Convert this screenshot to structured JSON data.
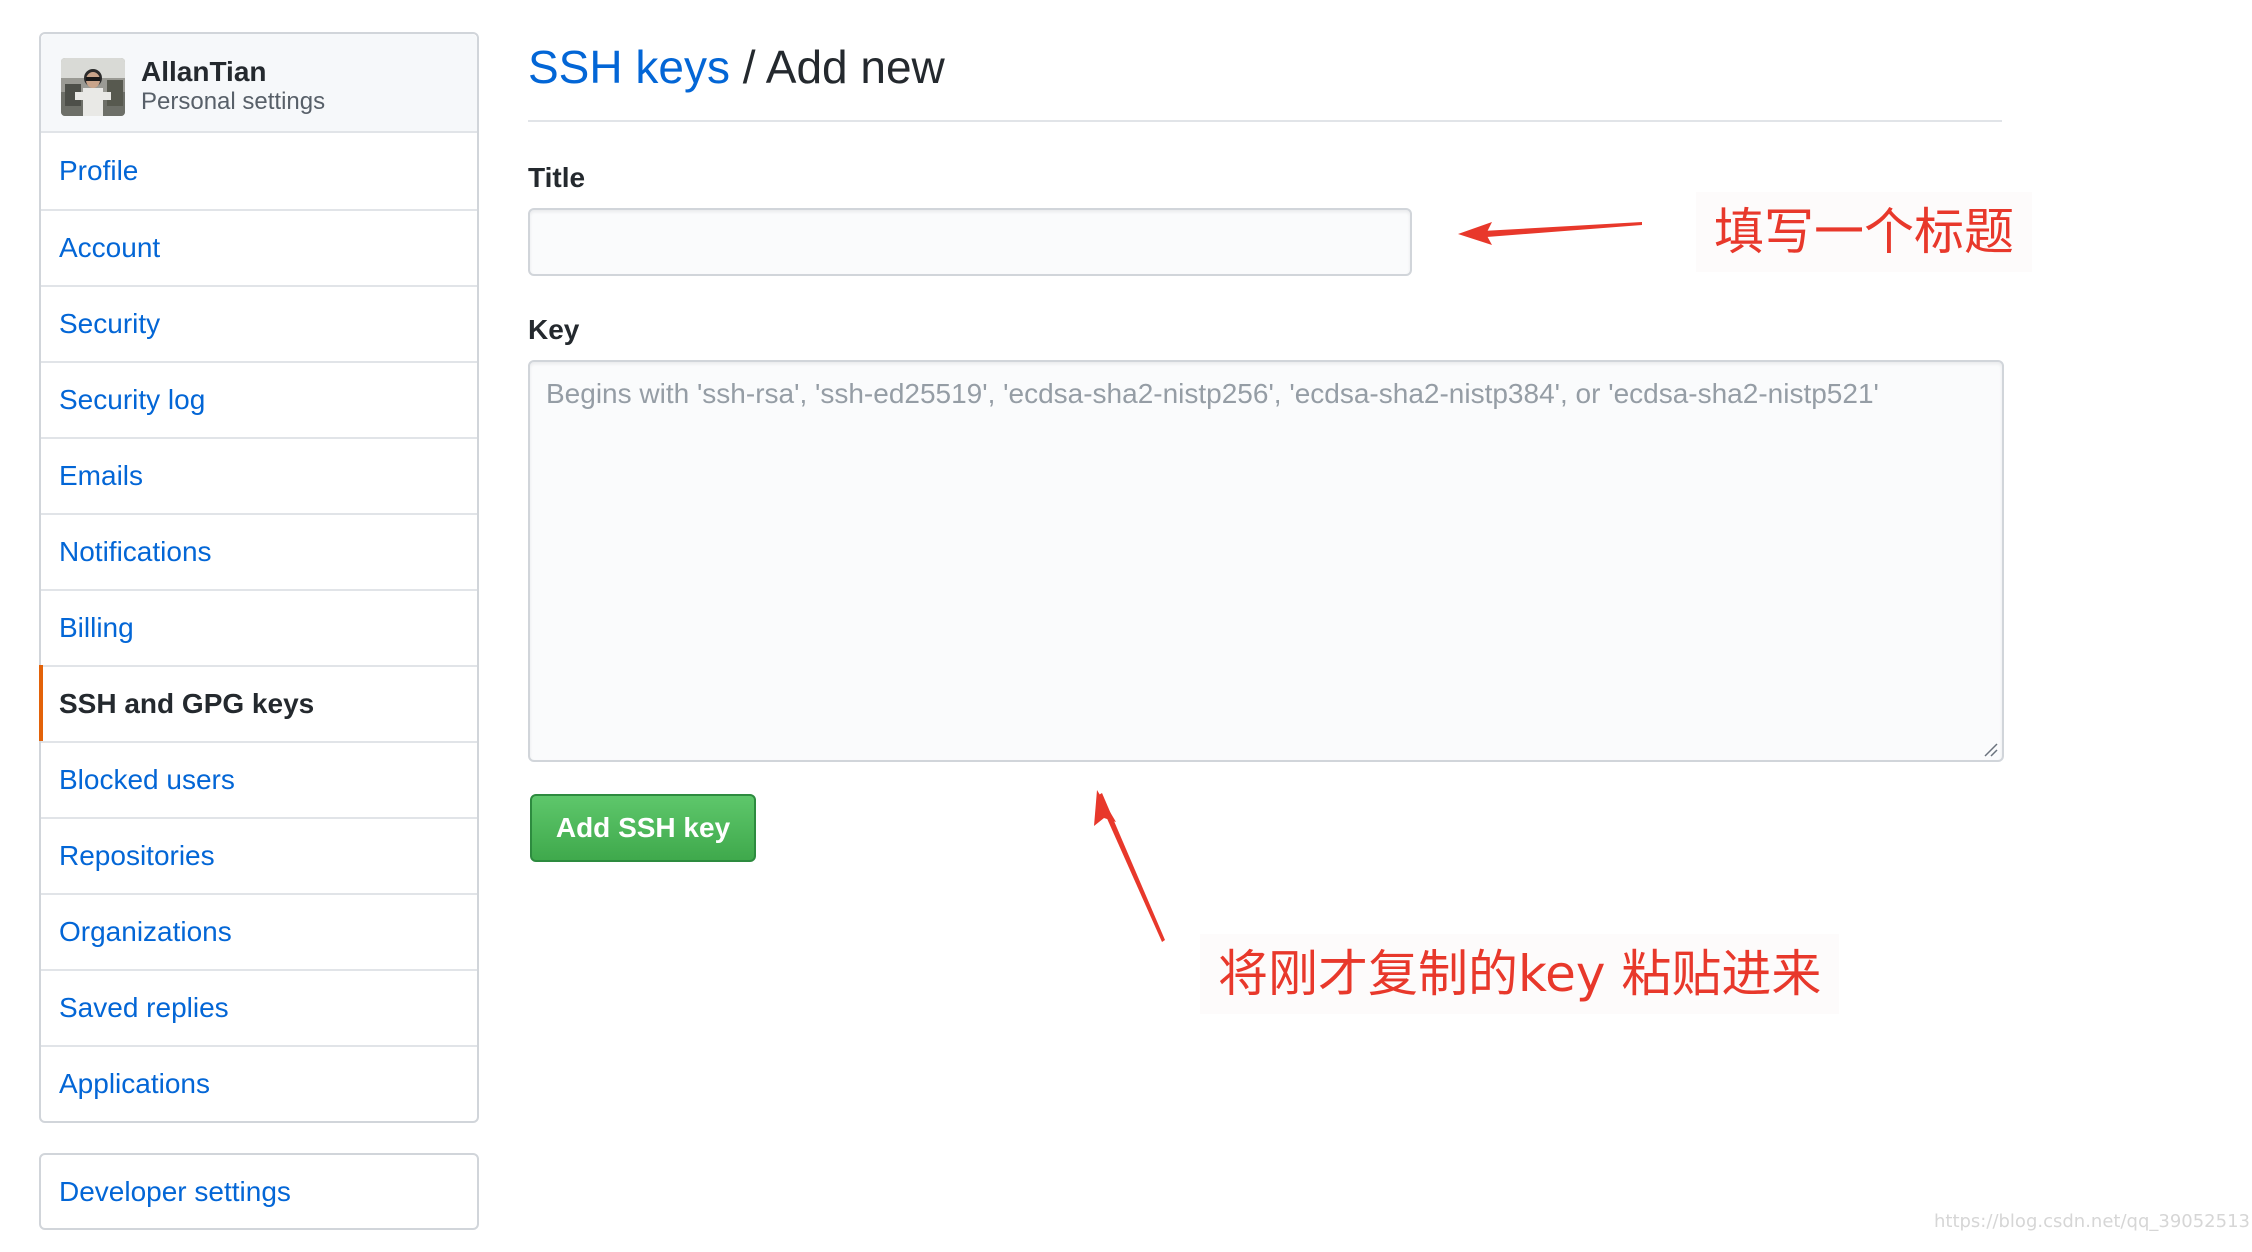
{
  "user": {
    "name": "AllanTian",
    "subtitle": "Personal settings"
  },
  "sidebar": {
    "items": [
      {
        "label": "Profile"
      },
      {
        "label": "Account"
      },
      {
        "label": "Security"
      },
      {
        "label": "Security log"
      },
      {
        "label": "Emails"
      },
      {
        "label": "Notifications"
      },
      {
        "label": "Billing"
      },
      {
        "label": "SSH and GPG keys",
        "selected": true
      },
      {
        "label": "Blocked users"
      },
      {
        "label": "Repositories"
      },
      {
        "label": "Organizations"
      },
      {
        "label": "Saved replies"
      },
      {
        "label": "Applications"
      }
    ],
    "developer_settings": "Developer settings",
    "selected_accent": "#e36209"
  },
  "header": {
    "link": "SSH keys",
    "separator": " / ",
    "current": "Add new"
  },
  "form": {
    "title_label": "Title",
    "title_value": "",
    "key_label": "Key",
    "key_value": "",
    "key_placeholder": "Begins with 'ssh-rsa', 'ssh-ed25519', 'ecdsa-sha2-nistp256', 'ecdsa-sha2-nistp384', or 'ecdsa-sha2-nistp521'",
    "submit_label": "Add SSH key"
  },
  "annotations": {
    "title_note": "填写一个标题",
    "key_note": "将刚才复制的key 粘贴进来",
    "color": "#e8382b"
  },
  "watermark": "https://blog.csdn.net/qq_39052513",
  "colors": {
    "link": "#0366d6",
    "button_green": "#3fa94c"
  }
}
